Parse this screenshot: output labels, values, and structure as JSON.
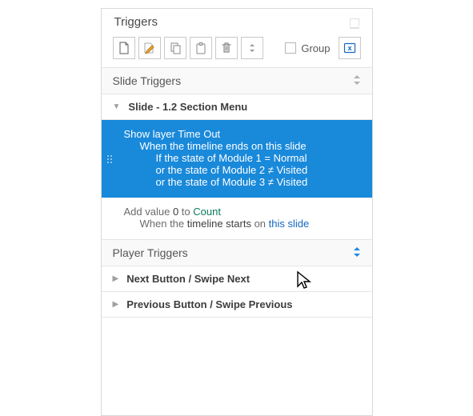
{
  "panel": {
    "title": "Triggers",
    "group_label": "Group"
  },
  "toolbar": {
    "icons": [
      "new",
      "edit",
      "copy",
      "paste",
      "delete",
      "reorder",
      "vars"
    ]
  },
  "sections": {
    "slide_triggers_title": "Slide Triggers",
    "player_triggers_title": "Player Triggers"
  },
  "slide": {
    "label": "Slide - 1.2 Section Menu"
  },
  "trigger_selected": {
    "action_prefix": "Show layer ",
    "action_target": "Time Out",
    "when_prefix": "When the timeline ends ",
    "when_target": "on this slide",
    "cond1_a": "If the state of ",
    "cond1_obj": "Module 1",
    "cond1_op": " = ",
    "cond1_val": "Normal",
    "cond2_a": "or the state of ",
    "cond2_obj": "Module 2",
    "cond2_op": " ≠ ",
    "cond2_val": "Visited",
    "cond3_a": "or the state of ",
    "cond3_obj": "Module 3",
    "cond3_op": " ≠ ",
    "cond3_val": "Visited"
  },
  "trigger2": {
    "action_a": "Add value ",
    "action_val": "0",
    "action_b": " to ",
    "action_var": "Count",
    "when_a": "When the ",
    "when_b": "timeline starts",
    "when_c": " on ",
    "when_d": "this slide"
  },
  "player": {
    "next": "Next Button / Swipe Next",
    "prev": "Previous Button / Swipe Previous"
  }
}
